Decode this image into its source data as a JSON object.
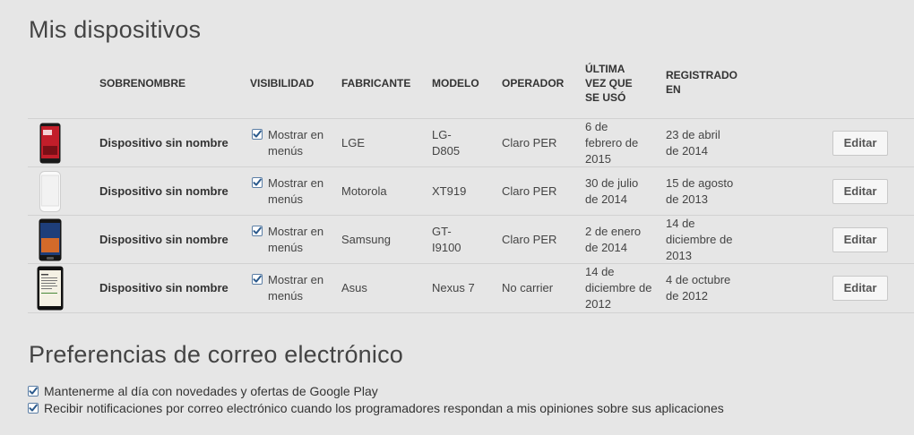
{
  "devices_section": {
    "title": "Mis dispositivos"
  },
  "table": {
    "headers": {
      "nickname": "SOBRENOMBRE",
      "visibility": "VISIBILIDAD",
      "maker": "FABRICANTE",
      "model": "MODELO",
      "operator": "OPERADOR",
      "last_used": [
        "ÚLTIMA",
        "VEZ QUE",
        "SE USÓ"
      ],
      "registered": [
        "REGISTRADO",
        "EN"
      ]
    },
    "rows": [
      {
        "image": "phone-lg-g2-icon",
        "name": "Dispositivo sin nombre",
        "visibility_checked": true,
        "visibility_label": [
          "Mostrar en",
          "menús"
        ],
        "maker": "LGE",
        "model": [
          "LG-",
          "D805"
        ],
        "operator": "Claro PER",
        "last_used": [
          "6 de",
          "febrero de",
          "2015"
        ],
        "registered": [
          "23 de abril",
          "de 2014"
        ],
        "edit": "Editar"
      },
      {
        "image": "phone-white-icon",
        "name": "Dispositivo sin nombre",
        "visibility_checked": true,
        "visibility_label": [
          "Mostrar en",
          "menús"
        ],
        "maker": "Motorola",
        "model": [
          "XT919"
        ],
        "operator": "Claro PER",
        "last_used": [
          "30 de julio",
          "de 2014"
        ],
        "registered": [
          "15 de agosto",
          "de 2013"
        ],
        "edit": "Editar"
      },
      {
        "image": "phone-galaxy-s2-icon",
        "name": "Dispositivo sin nombre",
        "visibility_checked": true,
        "visibility_label": [
          "Mostrar en",
          "menús"
        ],
        "maker": "Samsung",
        "model": [
          "GT-",
          "I9100"
        ],
        "operator": "Claro PER",
        "last_used": [
          "2 de enero",
          "de 2014"
        ],
        "registered": [
          "14 de",
          "diciembre de",
          "2013"
        ],
        "edit": "Editar"
      },
      {
        "image": "tablet-nexus-7-icon",
        "name": "Dispositivo sin nombre",
        "visibility_checked": true,
        "visibility_label": [
          "Mostrar en",
          "menús"
        ],
        "maker": "Asus",
        "model": [
          "Nexus 7"
        ],
        "operator": "No carrier",
        "last_used": [
          "14 de",
          "diciembre de",
          "2012"
        ],
        "registered": [
          "4 de octubre",
          "de 2012"
        ],
        "edit": "Editar"
      }
    ]
  },
  "email_section": {
    "title": "Preferencias de correo electrónico",
    "options": [
      {
        "checked": true,
        "label": "Mantenerme al día con novedades y ofertas de Google Play"
      },
      {
        "checked": true,
        "label": "Recibir notificaciones por correo electrónico cuando los programadores respondan a mis opiniones sobre sus aplicaciones"
      }
    ]
  },
  "colors": {
    "background": "#e6e6e6",
    "checkbox_accent": "#2b5a8c",
    "divider": "#d2d2d2"
  }
}
